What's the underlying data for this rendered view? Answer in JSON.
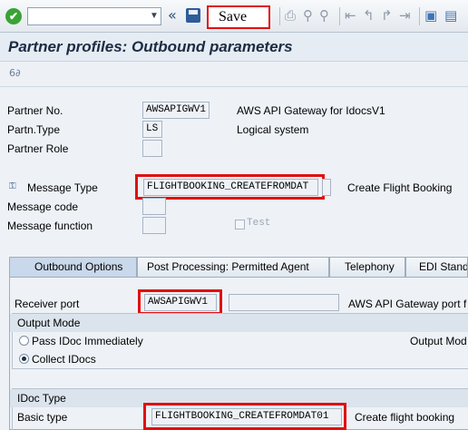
{
  "toolbar": {
    "command_value": "",
    "save_callout": "Save",
    "nav_glyph": "«",
    "dropdown_glyph": "▼",
    "ok_glyph": "✔"
  },
  "title": "Partner profiles: Outbound parameters",
  "header_fields": {
    "partner_no": {
      "label": "Partner No.",
      "value": "AWSAPIGWV1",
      "description": "AWS API Gateway for IdocsV1"
    },
    "partn_type": {
      "label": "Partn.Type",
      "value": "LS",
      "description": "Logical system"
    },
    "partner_role": {
      "label": "Partner Role",
      "value": ""
    }
  },
  "message_fields": {
    "message_type": {
      "label": "Message Type",
      "value": "FLIGHTBOOKING_CREATEFROMDAT",
      "description": "Create Flight Booking"
    },
    "message_code": {
      "label": "Message code",
      "value": ""
    },
    "message_function": {
      "label": "Message function",
      "value": ""
    },
    "test_label": "Test"
  },
  "tabs": [
    {
      "label": "Outbound Options",
      "active": true
    },
    {
      "label": "Post Processing: Permitted Agent",
      "active": false
    },
    {
      "label": "Telephony",
      "active": false
    },
    {
      "label": "EDI Standar",
      "active": false
    }
  ],
  "outbound": {
    "receiver_port": {
      "label": "Receiver port",
      "value": "AWSAPIGWV1",
      "description": "AWS API Gateway port f"
    },
    "output_mode": {
      "header": "Output Mode",
      "options": [
        {
          "label": "Pass IDoc Immediately",
          "selected": false
        },
        {
          "label": "Collect IDocs",
          "selected": true
        }
      ],
      "right_label": "Output Mod"
    },
    "idoc_type": {
      "header": "IDoc Type",
      "basic_type": {
        "label": "Basic type",
        "value": "FLIGHTBOOKING_CREATEFROMDAT01",
        "description": "Create flight booking"
      }
    }
  },
  "colors": {
    "highlight": "#e01010",
    "title": "#1b2c44",
    "ok": "#3aa335"
  }
}
